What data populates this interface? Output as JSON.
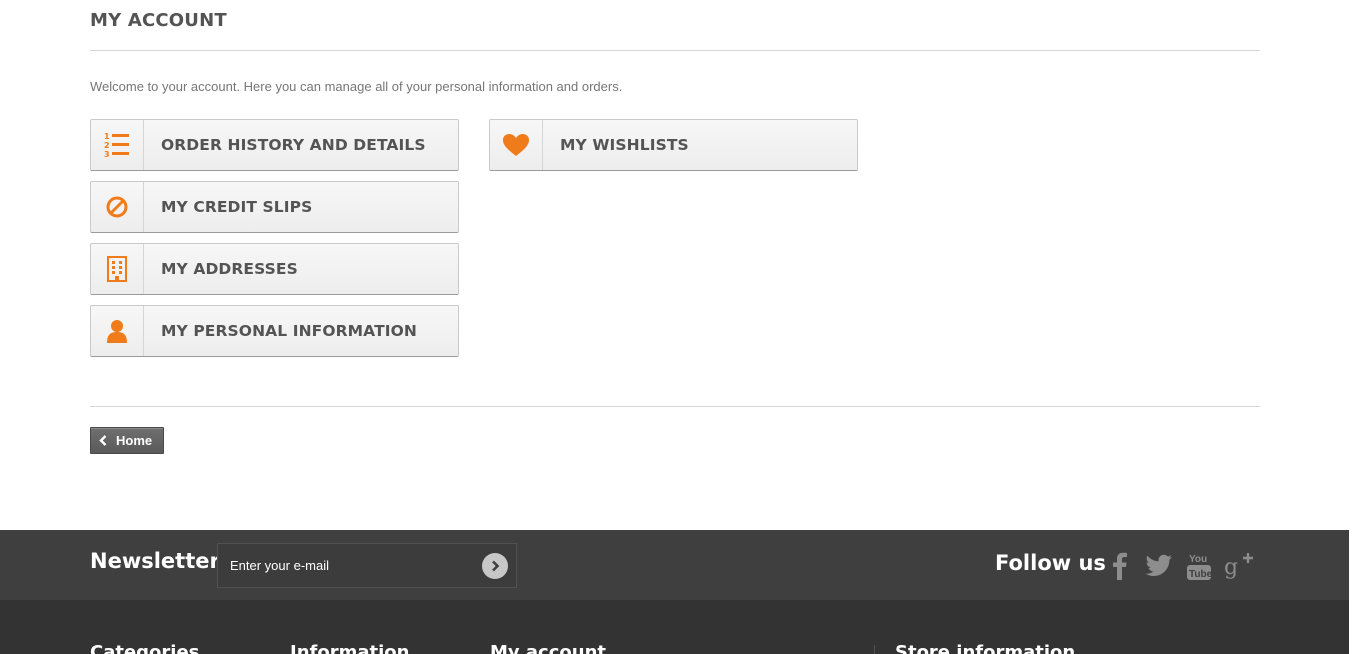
{
  "page": {
    "heading": "My account",
    "intro": "Welcome to your account. Here you can manage all of your personal information and orders."
  },
  "account_links": [
    {
      "label": "Order history and details",
      "icon": "list-numbered-icon"
    },
    {
      "label": "My credit slips",
      "icon": "ban-icon"
    },
    {
      "label": "My addresses",
      "icon": "building-icon"
    },
    {
      "label": "My personal information",
      "icon": "user-icon"
    },
    {
      "label": "My wishlists",
      "icon": "heart-icon"
    }
  ],
  "nav": {
    "home_label": "Home"
  },
  "footer": {
    "newsletter_title": "Newsletter",
    "newsletter_placeholder": "Enter your e-mail",
    "follow_title": "Follow us",
    "social": [
      "facebook-icon",
      "twitter-icon",
      "youtube-icon",
      "google-plus-icon"
    ],
    "columns": [
      "Categories",
      "Information",
      "My account",
      "Store information"
    ]
  },
  "colors": {
    "accent": "#f07b1a",
    "text_dark": "#555454",
    "footer_band": "#3f3f3f",
    "footer_bottom": "#333333"
  }
}
